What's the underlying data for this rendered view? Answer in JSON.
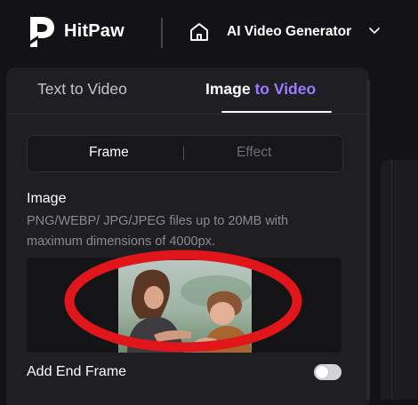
{
  "header": {
    "brand": "HitPaw",
    "app_title": "AI Video Generator",
    "logo_icon": "hitpaw-logo-icon",
    "home_icon": "home-icon",
    "dropdown_icon": "chevron-down-icon"
  },
  "tabs": {
    "text_to_video": "Text to Video",
    "image_to_video_a": "Image ",
    "image_to_video_b": "to Video",
    "active": "Image to Video"
  },
  "segment": {
    "frame": "Frame",
    "effect": "Effect",
    "active": "Frame"
  },
  "image_section": {
    "label": "Image",
    "hint": "PNG/WEBP/ JPG/JPEG files up to 20MB with maximum dimensions of 4000px."
  },
  "end_frame": {
    "label": "Add End Frame",
    "enabled": false
  },
  "colors": {
    "background": "#131316",
    "panel": "#1e1e23",
    "accent": "#9c7bff",
    "annotation": "#e0161b"
  }
}
